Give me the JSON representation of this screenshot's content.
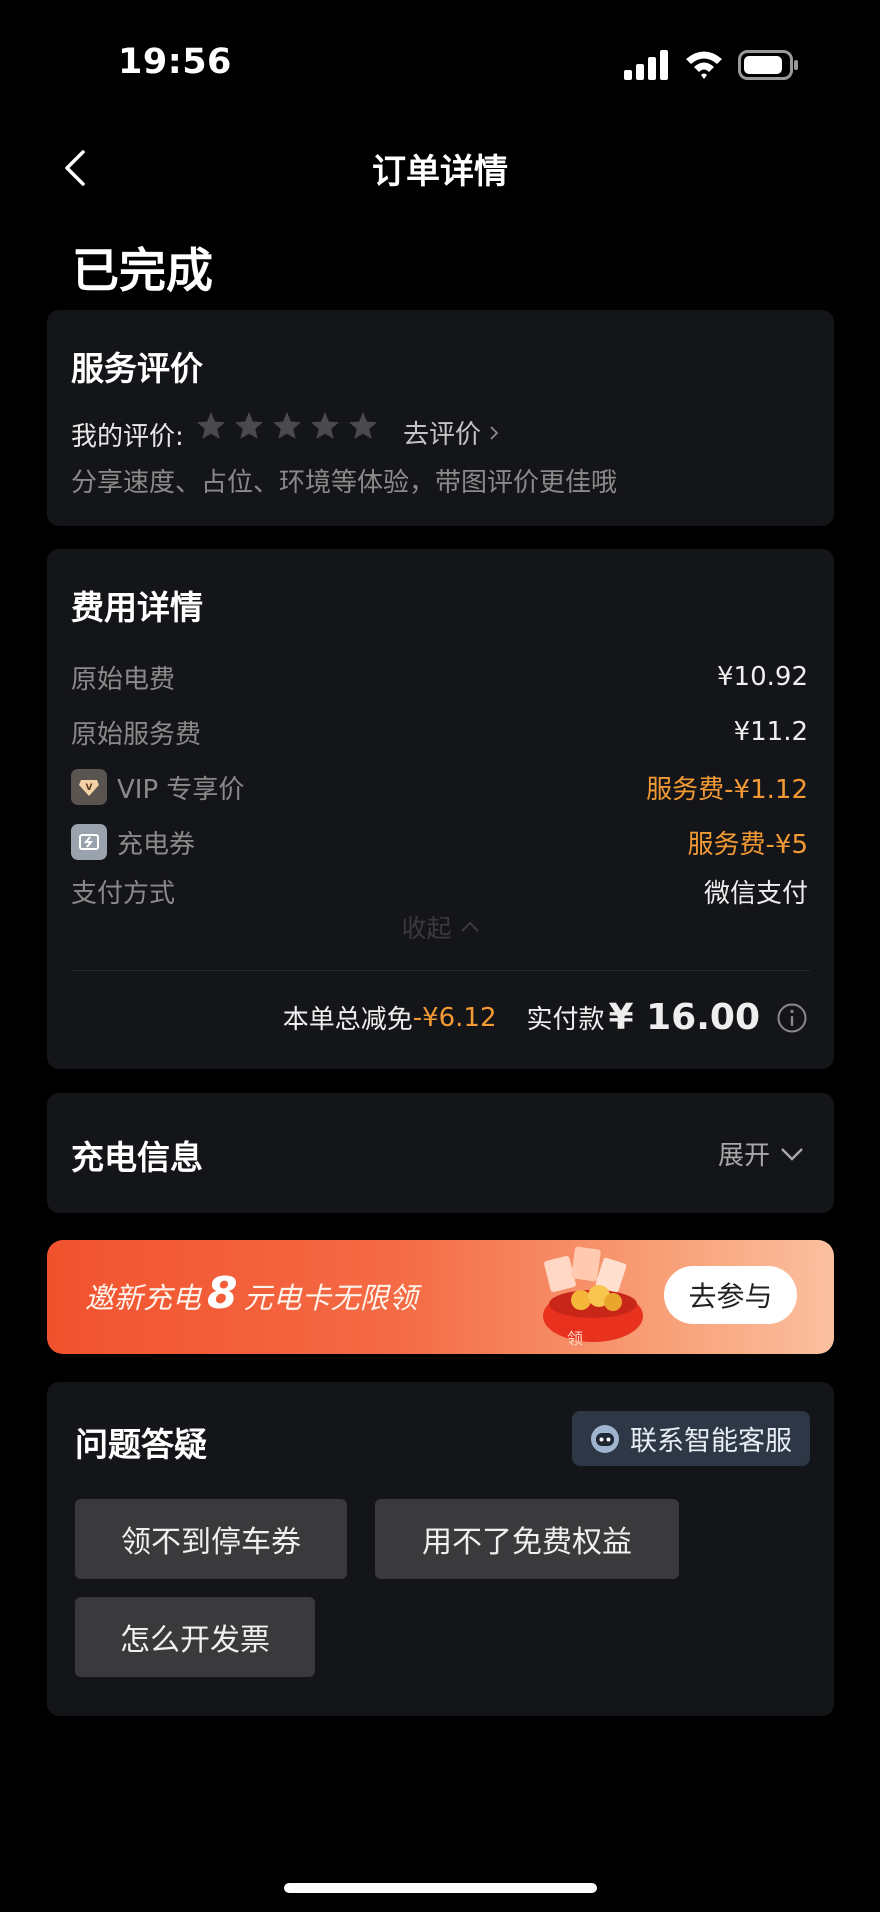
{
  "status_bar": {
    "time": "19:56"
  },
  "nav": {
    "title": "订单详情"
  },
  "order": {
    "status": "已完成"
  },
  "review": {
    "title": "服务评价",
    "my_review_label": "我的评价:",
    "rating": 0,
    "max_rating": 5,
    "go_review": "去评价",
    "hint": "分享速度、占位、环境等体验，带图评价更佳哦"
  },
  "fees": {
    "title": "费用详情",
    "rows": [
      {
        "label": "原始电费",
        "value": "¥10.92"
      },
      {
        "label": "原始服务费",
        "value": "¥11.2"
      },
      {
        "label": "VIP 专享价",
        "value": "服务费-¥1.12",
        "icon": "vip-icon"
      },
      {
        "label": "充电券",
        "value": "服务费-¥5",
        "icon": "coupon-icon"
      },
      {
        "label": "支付方式",
        "value": "微信支付"
      }
    ],
    "collapse": "收起",
    "total_discount_label": "本单总减免",
    "total_discount": "-¥6.12",
    "paid_label": "实付款",
    "paid_amount": "¥ 16.00"
  },
  "charging": {
    "title": "充电信息",
    "expand": "展开"
  },
  "banner": {
    "text_prefix": "邀新充电",
    "amount": "8",
    "text_suffix": "元电卡无限领",
    "button": "去参与"
  },
  "faq": {
    "title": "问题答疑",
    "service_button": "联系智能客服",
    "chips": [
      "领不到停车券",
      "用不了免费权益",
      "怎么开发票"
    ]
  },
  "colors": {
    "background": "#000000",
    "card": "#141518",
    "accent_orange": "#f39a34",
    "chip": "#3a3a3c",
    "service_button": "#2d3746"
  }
}
